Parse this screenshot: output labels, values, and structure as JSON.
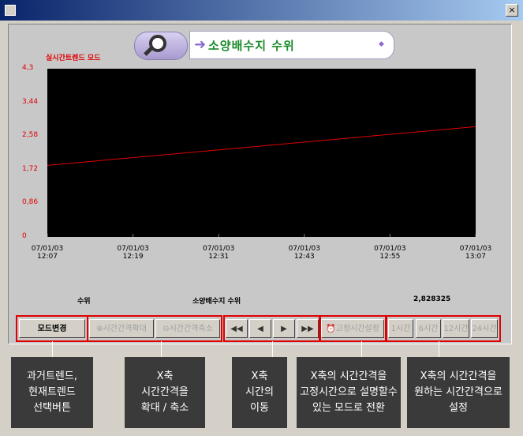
{
  "window": {
    "close_glyph": "×"
  },
  "header": {
    "title": "소양배수지 수위",
    "mode_label": "실시간트렌드 모드",
    "icon": "magnifier-icon"
  },
  "chart_data": {
    "type": "line",
    "y_ticks": [
      "4,3",
      "3,44",
      "2,58",
      "1,72",
      "0,86",
      "0"
    ],
    "ylim": [
      0,
      4.3
    ],
    "x_ticks": [
      {
        "date": "07/01/03",
        "time": "12:07"
      },
      {
        "date": "07/01/03",
        "time": "12:19"
      },
      {
        "date": "07/01/03",
        "time": "12:31"
      },
      {
        "date": "07/01/03",
        "time": "12:43"
      },
      {
        "date": "07/01/03",
        "time": "12:55"
      },
      {
        "date": "07/01/03",
        "time": "13:07"
      }
    ],
    "series": [
      {
        "color": "#e00000",
        "x": [
          "12:07",
          "13:07"
        ],
        "y": [
          1.83,
          2.82
        ]
      }
    ]
  },
  "status": {
    "col1": "수위",
    "col2": "소양배수지 수위",
    "col3": "2,828325"
  },
  "toolbar": {
    "mode_button": "모드변경",
    "zoom_in": "시간간격확대",
    "zoom_out": "시간간격축소",
    "first": "◀◀",
    "prev": "◀",
    "next": "▶",
    "last": "▶▶",
    "fixed_time": "고정시간설정",
    "h1": "1시간",
    "h6": "6시간",
    "h12": "12시간",
    "h24": "24시간"
  },
  "callouts": {
    "c1": "과거트렌드,\n현재트렌드\n선택버튼",
    "c2": "X축\n시간간격을\n확대 / 축소",
    "c3": "X축\n시간의\n이동",
    "c4": "X축의 시간간격을\n고정시간으로 설명할수\n있는 모드로 전환",
    "c5": "X축의 시간간격을\n원하는 시간간격으로\n설정"
  },
  "colors": {
    "plot_bg": "#000000",
    "line": "#e00000",
    "accent": "#e00000",
    "title": "#1a8a2a"
  }
}
